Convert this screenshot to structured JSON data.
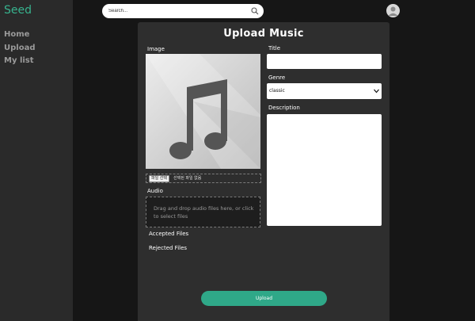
{
  "app": {
    "logo": "Seed"
  },
  "sidebar": {
    "items": [
      {
        "label": "Home"
      },
      {
        "label": "Upload"
      },
      {
        "label": "My list"
      }
    ]
  },
  "search": {
    "placeholder": "Search..."
  },
  "icons": {
    "search": "search-icon",
    "user": "user-avatar-icon",
    "music": "music-note-icon",
    "chevron": "chevron-down-icon"
  },
  "form": {
    "title": "Upload Music",
    "image_label": "Image",
    "file_button": "파일 선택",
    "file_status": "선택된 파일 없음",
    "audio_label": "Audio",
    "dropzone_text": "Drag and drop audio files here, or click to select files",
    "accepted_label": "Accepted Files",
    "rejected_label": "Rejected Files",
    "title_label": "Title",
    "title_value": "",
    "genre_label": "Genre",
    "genre_value": "classic",
    "description_label": "Description",
    "description_value": "",
    "upload_button": "Upload"
  },
  "colors": {
    "accent": "#37b38e",
    "button": "#2fa888",
    "panel": "#2e2e2e",
    "sidebar": "#2a2a2a",
    "background": "#161616"
  }
}
